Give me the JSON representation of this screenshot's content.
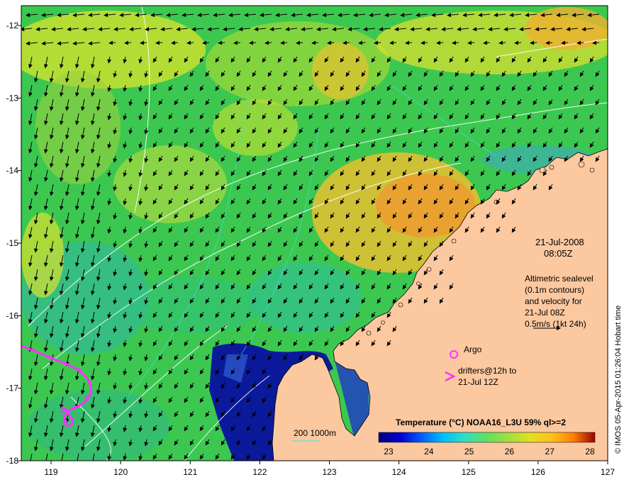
{
  "map": {
    "x_axis": {
      "ticks": [
        "119",
        "120",
        "121",
        "122",
        "123",
        "124",
        "125",
        "126",
        "127"
      ]
    },
    "y_axis": {
      "ticks": [
        "-12",
        "-13",
        "-14",
        "-15",
        "-16",
        "-17",
        "-18"
      ]
    },
    "date": "21-Jul-2008",
    "time": "08:05Z",
    "description_lines": [
      "Altimetric sealevel",
      "(0.1m contours)",
      "and velocity for",
      "21-Jul 08Z",
      "0.5m/s (1kt 24h)"
    ],
    "argo_label": "Argo",
    "drifters_lines": [
      "drifters@12h to",
      "21-Jul 12Z"
    ],
    "depth_label": "200  1000m",
    "colorbar": {
      "title": "Temperature (°C) NOAA16_L3U 59% ql>=2",
      "ticks": [
        "23",
        "24",
        "25",
        "26",
        "27",
        "28"
      ],
      "colors": [
        "#000080",
        "#0000d0",
        "#0060ff",
        "#00c0ff",
        "#30e0c0",
        "#60e060",
        "#a0e040",
        "#e0e020",
        "#ffc020",
        "#ff8000",
        "#e04000",
        "#a00000"
      ]
    },
    "credit": "© IMOS 05-Apr-2015 01:26:04 Hobart time",
    "colors": {
      "land": "#fbc8a0",
      "ocean_green": "#3cc850",
      "ocean_yellow": "#d8e030",
      "ocean_orange": "#f0a030",
      "ocean_teal": "#30b8a0",
      "ocean_deep_blue": "#0a1a9a",
      "drifter": "#ff30ff"
    }
  }
}
